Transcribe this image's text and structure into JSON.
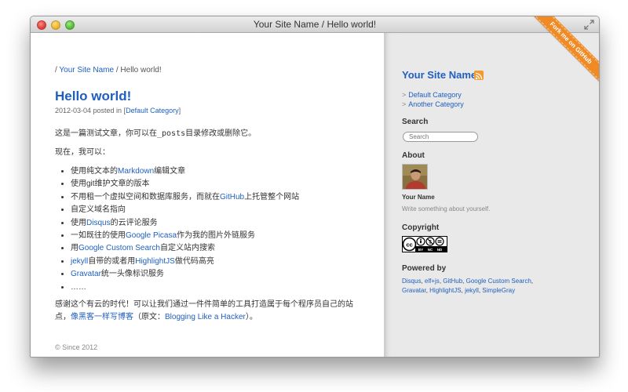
{
  "window": {
    "title": "Your Site Name / Hello world!"
  },
  "breadcrumb": {
    "sep1": "/",
    "home": "Your Site Name",
    "sep2": "/",
    "current": "Hello world!"
  },
  "post": {
    "title": "Hello world!",
    "meta_prefix": "2012-03-04 posted in [",
    "category": "Default Category",
    "meta_suffix": "]",
    "intro_before": "这是一篇测试文章，你可以在",
    "intro_code": "_posts",
    "intro_after": "目录修改或删除它。",
    "now_line": "现在，我可以：",
    "list": [
      {
        "before": "使用纯文本的",
        "link": "Markdown",
        "after": "编辑文章"
      },
      {
        "before": "使用git维护文章的版本",
        "link": "",
        "after": ""
      },
      {
        "before": "不用租一个虚拟空间和数据库服务，而就在",
        "link": "GitHub",
        "after": "上托管整个网站"
      },
      {
        "before": "自定义域名指向",
        "link": "",
        "after": ""
      },
      {
        "before": "使用",
        "link": "Disqus",
        "after": "的云评论服务"
      },
      {
        "before": "一如既往的使用",
        "link": "Google Picasa",
        "after": "作为我的图片外链服务"
      },
      {
        "before": "用",
        "link": "Google Custom Search",
        "after": "自定义站内搜索"
      },
      {
        "before": "",
        "link": "jekyll",
        "after": "自带的或者用"
      },
      {
        "before": "",
        "link": "Gravatar",
        "after": "统一头像标识服务"
      },
      {
        "before": "……",
        "link": "",
        "after": ""
      }
    ],
    "jekyll_link2": "HighlightJS",
    "jekyll_after2": "做代码高亮",
    "outro_before": "感谢这个有云的时代！可以让我们通过一件件简单的工具打造属于每个程序员自己的站点，",
    "outro_link": "像黑客一样写博客",
    "outro_mid": "（原文：",
    "outro_link2": "Blogging Like a Hacker",
    "outro_after": "）。"
  },
  "footer": {
    "text": "© Since 2012"
  },
  "sidebar": {
    "site_name": "Your Site Name",
    "categories": [
      {
        "arrow": ">",
        "label": "Default Category"
      },
      {
        "arrow": ">",
        "label": "Another Category"
      }
    ],
    "search_heading": "Search",
    "search_placeholder": "Search",
    "about_heading": "About",
    "author_name": "Your Name",
    "author_bio": "Write something about yourself.",
    "copyright_heading": "Copyright",
    "cc_labels": [
      "BY",
      "NC",
      "ND"
    ],
    "powered_heading": "Powered by",
    "powered_links": [
      "Disqus",
      "elf+js",
      "GitHub",
      "Google Custom Search",
      "Gravatar",
      "HighlightJS",
      "jekyll",
      "SimpleGray"
    ]
  },
  "ribbon": {
    "text": "Fork me on GitHub"
  },
  "colors": {
    "link": "#1f5fbf",
    "ribbon": "#f08a24",
    "sidebar_bg": "#e9e9e9",
    "rss": "#f29a2e"
  },
  "icons": [
    "close-button-icon",
    "minimize-button-icon",
    "zoom-button-icon",
    "fullscreen-resize-icon",
    "rss-icon",
    "creative-commons-icon"
  ]
}
